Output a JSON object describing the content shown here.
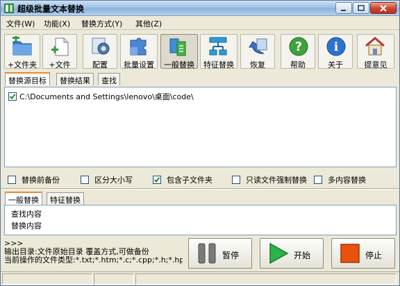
{
  "window": {
    "title": "超级批量文本替换"
  },
  "menu": [
    {
      "label": "文件(W)"
    },
    {
      "label": "功能(X)"
    },
    {
      "label": "替换方式(Y)"
    },
    {
      "label": "其他(Z)"
    }
  ],
  "toolbar": [
    {
      "label": "+文件夹",
      "icon": "add-folder-icon"
    },
    {
      "label": "+文件",
      "icon": "add-file-icon"
    },
    {
      "label": "配置",
      "icon": "gear-icon"
    },
    {
      "label": "批量设置",
      "icon": "puzzle-icon"
    },
    {
      "label": "一般替换",
      "icon": "replace-icon",
      "active": true
    },
    {
      "label": "特征替换",
      "icon": "structure-icon"
    },
    {
      "label": "恢复",
      "icon": "undo-icon"
    },
    {
      "label": "帮助",
      "icon": "help-icon"
    },
    {
      "label": "关于",
      "icon": "info-icon"
    },
    {
      "label": "提意见",
      "icon": "home-icon"
    }
  ],
  "top_tabs": [
    {
      "label": "替换源目标",
      "selected": true
    },
    {
      "label": "替换结果"
    },
    {
      "label": "查找"
    }
  ],
  "source_list": [
    {
      "checked": true,
      "path": "C:\\Documents and Settings\\lenovo\\桌面\\code\\"
    }
  ],
  "options": [
    {
      "label": "替换前备份",
      "checked": false
    },
    {
      "label": "区分大小写",
      "checked": false
    },
    {
      "label": "包含子文件夹",
      "checked": true
    },
    {
      "label": "只读文件强制替换",
      "checked": false
    },
    {
      "label": "多内容替换",
      "checked": false
    }
  ],
  "mode_tabs": [
    {
      "label": "一般替换",
      "selected": true
    },
    {
      "label": "特征替换"
    }
  ],
  "replace": {
    "find_label": "查找内容",
    "replace_label": "替换内容"
  },
  "log": {
    "line1": ">>>",
    "line2": "输出目录:文件原始目录    覆盖方式,可做备份",
    "line3": "当前操作的文件类型:*.txt;*.htm;*.c;*.cpp;*.h;*.hpp;*."
  },
  "actions": {
    "pause_label": "暂停",
    "start_label": "开始",
    "stop_label": "停止"
  },
  "colors": {
    "accent": "#e68b2c",
    "start_green": "#2bb34a",
    "stop_orange": "#e8520c"
  }
}
